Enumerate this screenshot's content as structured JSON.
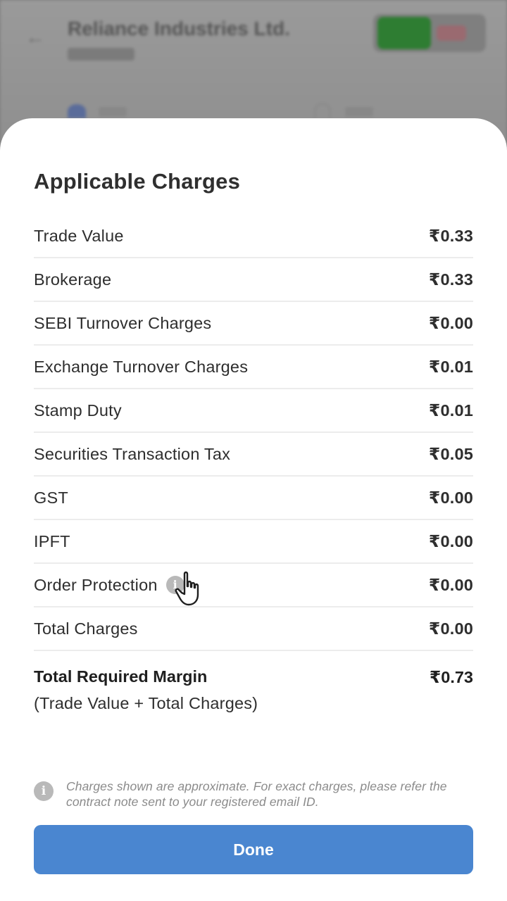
{
  "background": {
    "back_icon": "←",
    "stock_title": "Reliance Industries Ltd.",
    "buy_color": "#2e7d32",
    "sell_color": "#9a6a70"
  },
  "sheet": {
    "title": "Applicable Charges",
    "rows": [
      {
        "label": "Trade Value",
        "value": "₹0.33"
      },
      {
        "label": "Brokerage",
        "value": "₹0.33"
      },
      {
        "label": "SEBI Turnover Charges",
        "value": "₹0.00"
      },
      {
        "label": "Exchange Turnover Charges",
        "value": "₹0.01"
      },
      {
        "label": "Stamp Duty",
        "value": "₹0.01"
      },
      {
        "label": "Securities Transaction Tax",
        "value": "₹0.05"
      },
      {
        "label": "GST",
        "value": "₹0.00"
      },
      {
        "label": "IPFT",
        "value": "₹0.00"
      },
      {
        "label": "Order Protection",
        "value": "₹0.00",
        "info_icon": "info-icon"
      },
      {
        "label": "Total Charges",
        "value": "₹0.00"
      }
    ],
    "total": {
      "label": "Total Required Margin",
      "value": "₹0.73",
      "sub": "(Trade Value + Total Charges)"
    },
    "note": {
      "icon": "info-icon",
      "text": "Charges shown are approximate. For exact charges, please refer the contract note sent to your registered email ID."
    },
    "done_label": "Done",
    "accent_color": "#4a86d0"
  }
}
